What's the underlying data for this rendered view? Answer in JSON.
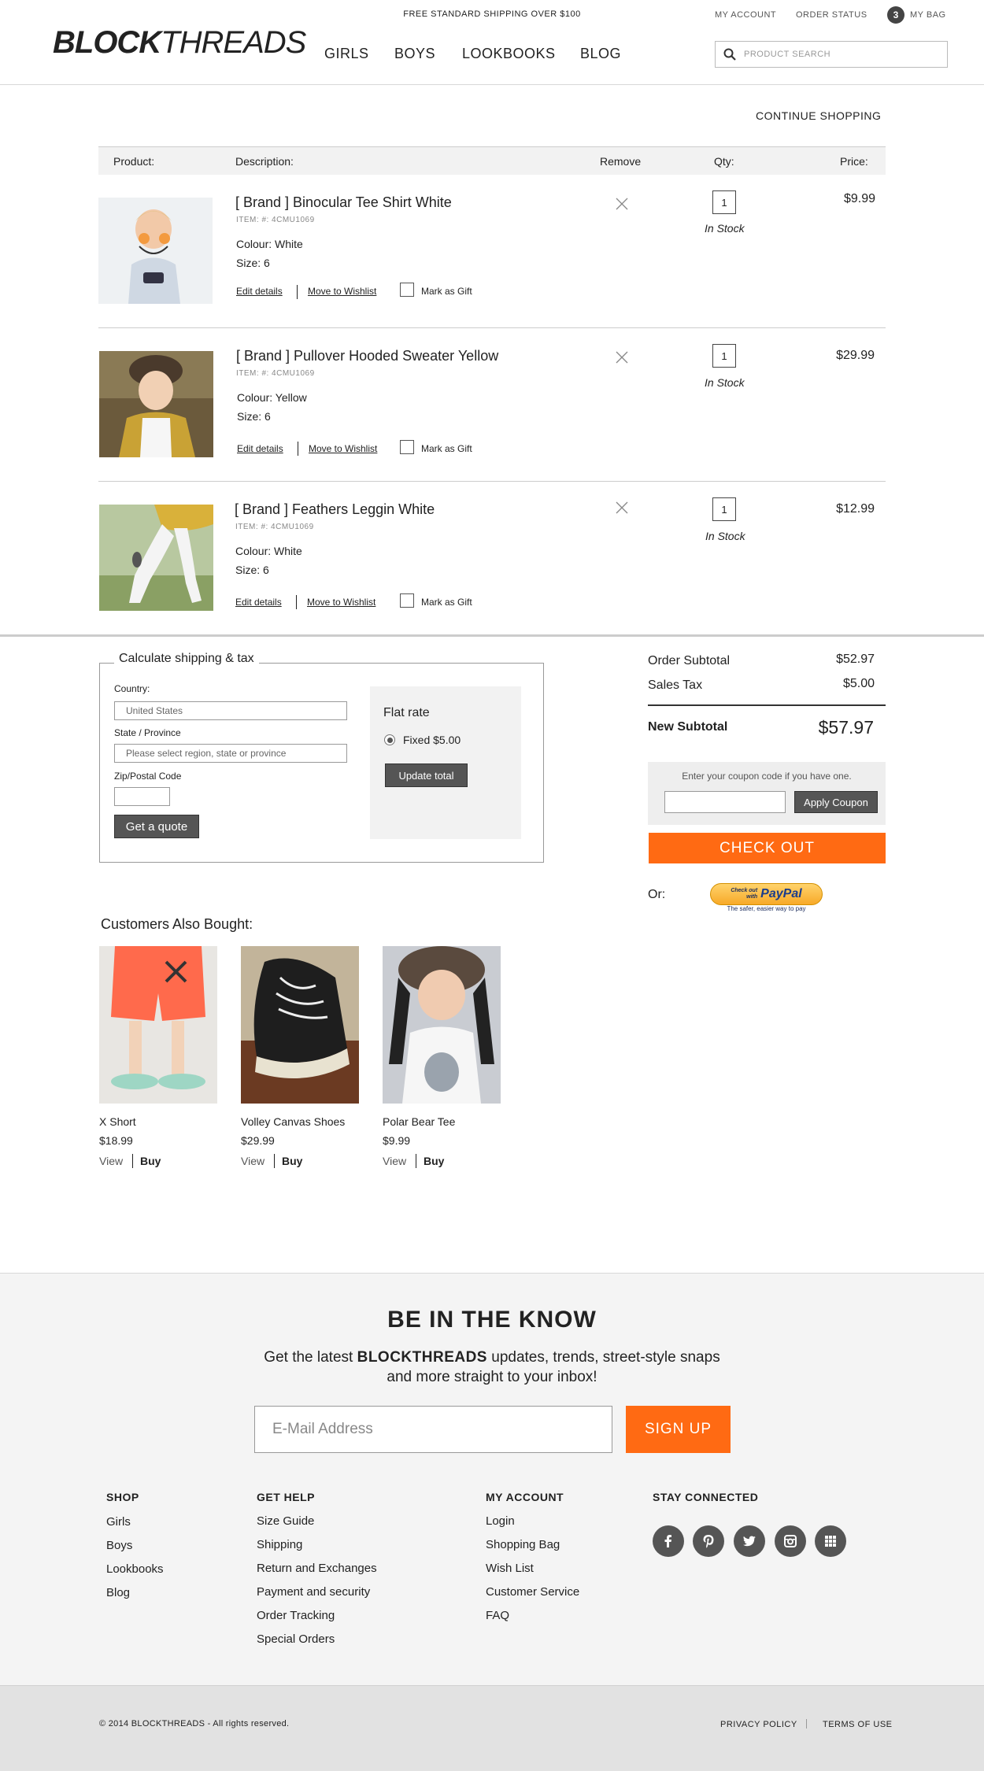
{
  "header": {
    "shipping_message": "FREE STANDARD SHIPPING OVER $100",
    "my_account": "MY ACCOUNT",
    "order_status": "ORDER STATUS",
    "bag_count": "3",
    "my_bag": "MY BAG",
    "logo_bold": "BLOCK",
    "logo_light": "THREADS",
    "nav": [
      "GIRLS",
      "BOYS",
      "LOOKBOOKS",
      "BLOG"
    ],
    "search_placeholder": "PRODUCT SEARCH"
  },
  "cart": {
    "continue_shopping": "CONTINUE SHOPPING",
    "columns": [
      "Product:",
      "Description:",
      "Remove",
      "Qty:",
      "Price:"
    ],
    "items": [
      {
        "name": "[ Brand ] Binocular Tee Shirt White",
        "sku": "ITEM: #: 4CMU1069",
        "colour": "Colour: White",
        "size": "Size: 6",
        "qty": "1",
        "stock": "In Stock",
        "price": "$9.99",
        "image": "boy-white-tee-photo"
      },
      {
        "name": "[ Brand ] Pullover Hooded Sweater Yellow",
        "sku": "ITEM: #: 4CMU1069",
        "colour": "Colour: Yellow",
        "size": "Size: 6",
        "qty": "1",
        "stock": "In Stock",
        "price": "$29.99",
        "image": "girl-yellow-sweater-photo"
      },
      {
        "name": "[ Brand ] Feathers Leggin White",
        "sku": "ITEM: #: 4CMU1069",
        "colour": "Colour: White",
        "size": "Size: 6",
        "qty": "1",
        "stock": "In Stock",
        "price": "$12.99",
        "image": "white-leggings-photo"
      }
    ],
    "edit_details": "Edit details",
    "move_to_wishlist": "Move to Wishlist",
    "mark_as_gift": "Mark as Gift"
  },
  "shipping": {
    "title": "Calculate shipping & tax",
    "country_label": "Country:",
    "country_value": "United States",
    "state_label": "State / Province",
    "state_placeholder": "Please select region, state or province",
    "zip_label": "Zip/Postal Code",
    "quote_button": "Get a quote",
    "flat_rate": "Flat rate",
    "fixed_option": "Fixed $5.00",
    "update_button": "Update total"
  },
  "totals": {
    "subtotal_label": "Order Subtotal",
    "subtotal_value": "$52.97",
    "tax_label": "Sales Tax",
    "tax_value": "$5.00",
    "new_subtotal_label": "New Subtotal",
    "new_subtotal_value": "$57.97",
    "coupon_prompt": "Enter your coupon code if you have one.",
    "apply_coupon": "Apply Coupon",
    "checkout": "CHECK OUT",
    "or": "Or:",
    "paypal_line1": "Check out",
    "paypal_line2": "with",
    "paypal_brand": "PayPal",
    "paypal_tagline": "The safer, easier way to pay"
  },
  "also_bought": {
    "title": "Customers Also Bought:",
    "view": "View",
    "buy": "Buy",
    "items": [
      {
        "name": "X Short",
        "price": "$18.99"
      },
      {
        "name": "Volley Canvas Shoes",
        "price": "$29.99"
      },
      {
        "name": "Polar Bear Tee",
        "price": "$9.99"
      }
    ]
  },
  "newsletter": {
    "title": "BE IN THE KNOW",
    "line1_pre": "Get the latest ",
    "line1_brand": "BLOCKTHREADS",
    "line1_post": " updates, trends, street-style snaps",
    "line2": "and more straight to your inbox!",
    "email_placeholder": "E-Mail Address",
    "signup": "SIGN UP"
  },
  "footer": {
    "shop": {
      "title": "SHOP",
      "links": [
        "Girls",
        "Boys",
        "Lookbooks",
        "Blog"
      ]
    },
    "help": {
      "title": "GET HELP",
      "links": [
        "Size Guide",
        "Shipping",
        "Return and Exchanges",
        "Payment and security",
        "Order Tracking",
        "Special Orders"
      ]
    },
    "account": {
      "title": "MY ACCOUNT",
      "links": [
        "Login",
        "Shopping Bag",
        "Wish List",
        "Customer Service",
        "FAQ"
      ]
    },
    "connected": {
      "title": "STAY CONNECTED",
      "icons": [
        "facebook-icon",
        "pinterest-icon",
        "twitter-icon",
        "instagram-icon",
        "grid-icon"
      ]
    },
    "copyright": "© 2014 BLOCKTHREADS - All rights reserved.",
    "privacy": "PRIVACY POLICY",
    "terms": "TERMS OF USE"
  },
  "colors": {
    "accent": "#ff6a13",
    "dark_button": "#555555",
    "footer_bg": "#f4f4f4"
  }
}
